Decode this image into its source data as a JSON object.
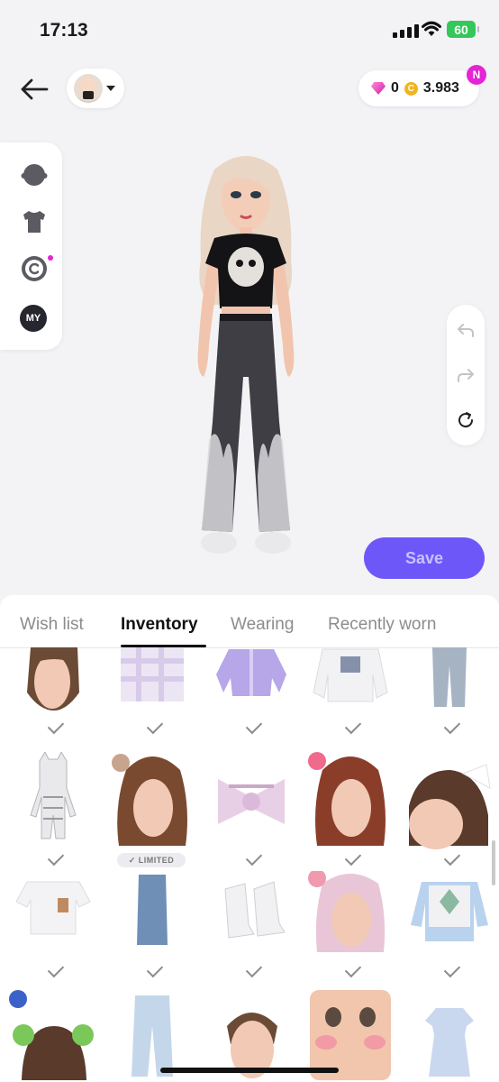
{
  "status_bar": {
    "time": "17:13",
    "battery": "60"
  },
  "header": {
    "diamonds": "0",
    "coins": "3.983",
    "coin_symbol": "C",
    "notification_badge": "N"
  },
  "side_panel": {
    "my_label": "MY"
  },
  "save_button": {
    "label": "Save"
  },
  "tabs": [
    {
      "label": "Wish list",
      "active": false
    },
    {
      "label": "Inventory",
      "active": true
    },
    {
      "label": "Wearing",
      "active": false
    },
    {
      "label": "Recently worn",
      "active": false
    }
  ],
  "inventory": {
    "limited_label": "✓ LIMITED",
    "rows": [
      [
        "hairstyle-brown-long",
        "plaid-skirt",
        "lilac-cardigan",
        "white-sweatshirt",
        "light-wash-jeans"
      ],
      [
        "cat-onesie",
        "hairstyle-brown-wavy",
        "pink-bow-top",
        "hairstyle-auburn-wavy",
        "hairstyle-with-bow"
      ],
      [
        "white-crop-tee",
        "denim-midi-skirt",
        "white-platform-boots",
        "hairstyle-pink-silver",
        "argyle-sweater-vest"
      ],
      [
        "alien-headband",
        "light-wide-jeans",
        "hairstyle-bun",
        "face-blush",
        "light-blue-dress"
      ]
    ]
  },
  "colors": {
    "accent": "#6e57f8",
    "badge": "#e524d6",
    "battery": "#34c759"
  }
}
